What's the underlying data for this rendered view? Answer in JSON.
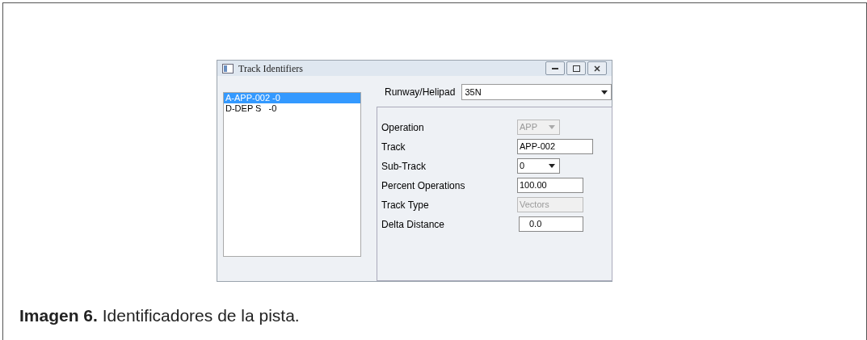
{
  "window": {
    "title": "Track Identifiers"
  },
  "tracks": [
    {
      "label": "A-APP-002 -0",
      "selected": true
    },
    {
      "label": "D-DEP S   -0",
      "selected": false
    }
  ],
  "runway": {
    "label": "Runway/Helipad",
    "value": "35N"
  },
  "fields": [
    {
      "label": "Operation",
      "value": "APP",
      "kind": "combo",
      "disabled": true
    },
    {
      "label": "Track",
      "value": "APP-002",
      "kind": "text",
      "disabled": false
    },
    {
      "label": "Sub-Track",
      "value": "0",
      "kind": "combo",
      "disabled": false
    },
    {
      "label": "Percent Operations",
      "value": "100.00",
      "kind": "text",
      "disabled": false
    },
    {
      "label": "Track Type",
      "value": "Vectors",
      "kind": "text",
      "disabled": true
    },
    {
      "label": "Delta Distance",
      "value": "0.0",
      "kind": "number",
      "disabled": false
    }
  ],
  "caption": "**Imagen 6.** Identificadores de la pista."
}
